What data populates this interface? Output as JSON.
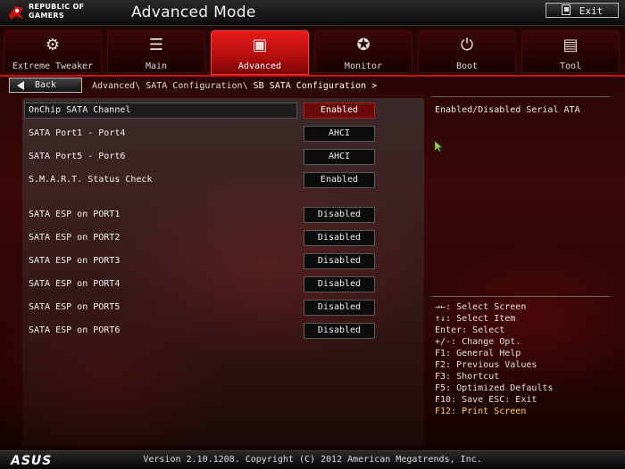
{
  "header": {
    "brand_line1": "REPUBLIC OF",
    "brand_line2": "GAMERS",
    "mode_title": "Advanced Mode",
    "exit_label": "Exit"
  },
  "tabs": [
    {
      "label": "Extreme Tweaker",
      "icon": "tweaker-icon",
      "glyph": "⚙"
    },
    {
      "label": "Main",
      "icon": "list-icon",
      "glyph": "☰"
    },
    {
      "label": "Advanced",
      "icon": "advanced-icon",
      "glyph": "▣",
      "active": true
    },
    {
      "label": "Monitor",
      "icon": "monitor-icon",
      "glyph": "✪"
    },
    {
      "label": "Boot",
      "icon": "power-icon",
      "glyph": "⏻"
    },
    {
      "label": "Tool",
      "icon": "tool-icon",
      "glyph": "▤"
    }
  ],
  "breadcrumb": {
    "back_label": "Back",
    "path": "Advanced\\ SATA Configuration\\ ",
    "current": "SB SATA Configuration >"
  },
  "settings": [
    {
      "label": "OnChip SATA Channel",
      "value": "Enabled",
      "selected": true
    },
    {
      "label": "SATA Port1 - Port4",
      "value": "AHCI"
    },
    {
      "label": "SATA Port5 - Port6",
      "value": "AHCI"
    },
    {
      "label": "S.M.A.R.T. Status Check",
      "value": "Enabled"
    },
    {
      "label": "SATA ESP on PORT1",
      "value": "Disabled"
    },
    {
      "label": "SATA ESP on PORT2",
      "value": "Disabled"
    },
    {
      "label": "SATA ESP on PORT3",
      "value": "Disabled"
    },
    {
      "label": "SATA ESP on PORT4",
      "value": "Disabled"
    },
    {
      "label": "SATA ESP on PORT5",
      "value": "Disabled"
    },
    {
      "label": "SATA ESP on PORT6",
      "value": "Disabled"
    }
  ],
  "help": {
    "description": "Enabled/Disabled Serial ATA",
    "keys": [
      "→←: Select Screen",
      "↑↓: Select Item",
      "Enter: Select",
      "+/-: Change Opt.",
      "F1: General Help",
      "F2: Previous Values",
      "F3: Shortcut",
      "F5: Optimized Defaults",
      "F10: Save  ESC: Exit",
      "F12: Print Screen"
    ]
  },
  "footer": {
    "brand": "ASUS",
    "version": "Version 2.10.1208. Copyright (C) 2012 American Megatrends, Inc."
  },
  "colors": {
    "accent": "#d01010",
    "highlight_key": "#ffd84a"
  }
}
